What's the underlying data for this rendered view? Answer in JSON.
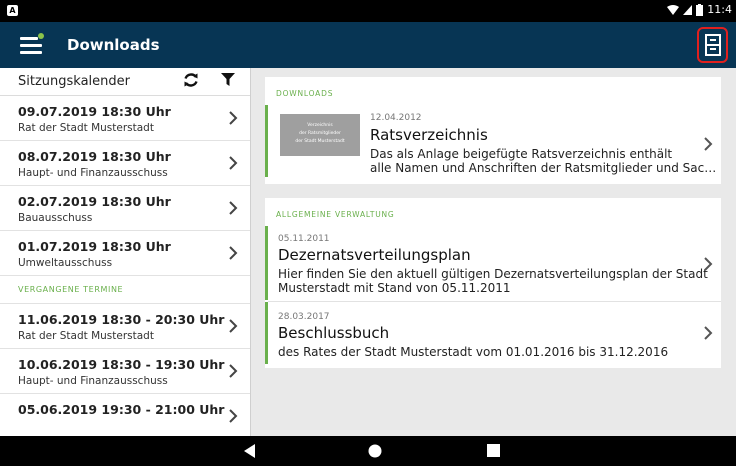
{
  "status_bar": {
    "notification_icon": "A",
    "time": "11:4"
  },
  "app_bar": {
    "title": "Downloads"
  },
  "left_panel": {
    "header_label": "Sitzungskalender",
    "upcoming": [
      {
        "date": "09.07.2019 18:30 Uhr",
        "body": "Rat der Stadt Musterstadt"
      },
      {
        "date": "08.07.2019 18:30 Uhr",
        "body": "Haupt- und Finanzausschuss"
      },
      {
        "date": "02.07.2019 18:30 Uhr",
        "body": "Bauausschuss"
      },
      {
        "date": "01.07.2019 18:30 Uhr",
        "body": "Umweltausschuss"
      }
    ],
    "past_section_label": "VERGANGENE TERMINE",
    "past": [
      {
        "date": "11.06.2019 18:30 - 20:30 Uhr",
        "body": "Rat der Stadt Musterstadt"
      },
      {
        "date": "10.06.2019 18:30 - 19:30 Uhr",
        "body": "Haupt- und Finanzausschuss"
      },
      {
        "date": "05.06.2019 19:30 - 21:00 Uhr",
        "body": ""
      }
    ]
  },
  "downloads_card": {
    "section_label": "DOWNLOADS",
    "item": {
      "date": "12.04.2012",
      "title": "Ratsverzeichnis",
      "desc_line1": "Das als Anlage beigefügte Ratsverzeichnis enthält",
      "desc_line2": "alle Namen und Anschriften der Ratsmitglieder und Sac…",
      "thumb_line1": "Verzeichnis",
      "thumb_line2": "der Ratsmitglieder",
      "thumb_line3": "der Stadt Musterstadt"
    }
  },
  "verwaltung_card": {
    "section_label": "ALLGEMEINE VERWALTUNG",
    "items": [
      {
        "date": "05.11.2011",
        "title": "Dezernatsverteilungsplan",
        "desc_line1": "Hier finden Sie den aktuell gültigen Dezernatsverteilungsplan der Stadt",
        "desc_line2": "Musterstadt mit Stand von 05.11.2011"
      },
      {
        "date": "28.03.2017",
        "title": "Beschlussbuch",
        "desc_line1": "des Rates der Stadt Musterstadt vom 01.01.2016 bis 31.12.2016"
      }
    ]
  },
  "colors": {
    "app_bar": "#073554",
    "accent_green": "#6ab04c",
    "highlight_red": "#e0201e"
  },
  "icons": [
    "menu-icon",
    "archive-icon",
    "sync-icon",
    "filter-icon",
    "chevron-right-icon",
    "back-icon",
    "home-icon",
    "recents-icon"
  ]
}
